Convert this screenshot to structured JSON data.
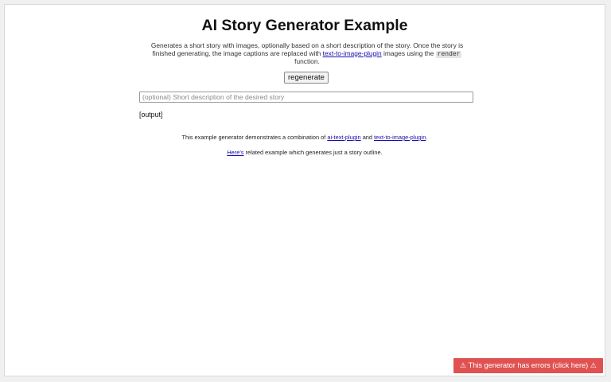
{
  "page": {
    "title": "AI Story Generator Example",
    "description": {
      "part1": "Generates a short story with images, optionally based on a short description of the story. Once the story is finished generating, the image captions are replaced with ",
      "link": "text-to-image-plugin",
      "part2": " images using the ",
      "code": "render",
      "part3": " function."
    },
    "regenerate_label": "regenerate",
    "input": {
      "placeholder": "(optional) Short description of the desired story",
      "value": ""
    },
    "output_label": "[output]",
    "info1": {
      "prefix": "This example generator demonstrates a combination of ",
      "link1": "ai-text-plugin",
      "middle": " and ",
      "link2": "text-to-image-plugin",
      "suffix": "."
    },
    "info2": {
      "link": "Here's",
      "suffix": " related example which generates just a story outline."
    },
    "error_button": "⚠ This generator has errors (click here) ⚠"
  },
  "colors": {
    "link": "#1a0dab",
    "error_bg": "#e05252",
    "page_bg": "#ffffff",
    "outer_bg": "#f0f0f0"
  }
}
